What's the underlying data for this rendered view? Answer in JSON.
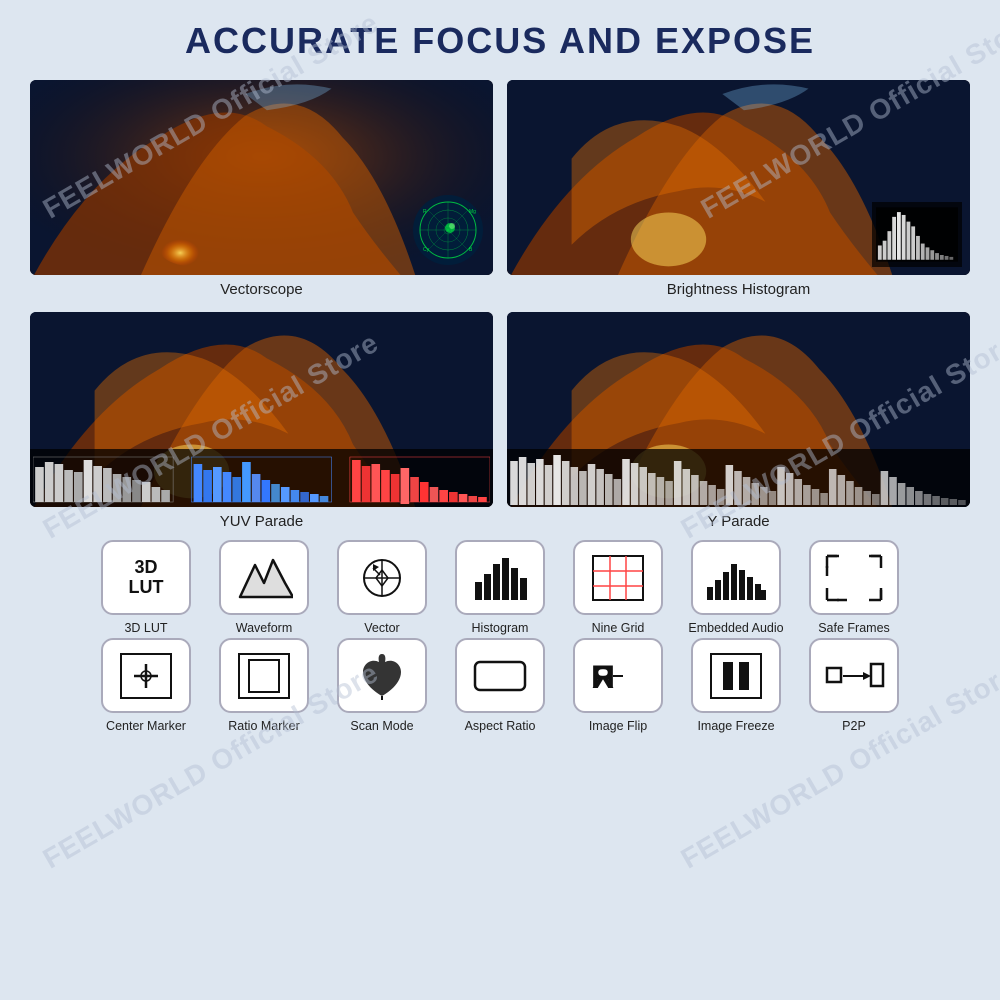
{
  "title": "ACCURATE FOCUS AND EXPOSE",
  "watermark": "FEELWORLD Official Store",
  "images": [
    {
      "id": "vectorscope",
      "caption": "Vectorscope",
      "overlay": "vectorscope"
    },
    {
      "id": "brightness-histogram",
      "caption": "Brightness Histogram",
      "overlay": "histogram"
    },
    {
      "id": "yuv-parade",
      "caption": "YUV Parade",
      "overlay": "yuv"
    },
    {
      "id": "y-parade",
      "caption": "Y Parade",
      "overlay": "y-parade"
    }
  ],
  "icons_row1": [
    {
      "id": "3d-lut",
      "label": "3D LUT",
      "type": "3dlut"
    },
    {
      "id": "waveform",
      "label": "Waveform",
      "type": "waveform"
    },
    {
      "id": "vector",
      "label": "Vector",
      "type": "vector"
    },
    {
      "id": "histogram",
      "label": "Histogram",
      "type": "histogram"
    },
    {
      "id": "nine-grid",
      "label": "Nine Grid",
      "type": "ninegrid"
    },
    {
      "id": "embedded-audio",
      "label": "Embedded Audio",
      "type": "audio"
    },
    {
      "id": "safe-frames",
      "label": "Safe Frames",
      "type": "safeframes"
    }
  ],
  "icons_row2": [
    {
      "id": "center-marker",
      "label": "Center Marker",
      "type": "centermarker"
    },
    {
      "id": "ratio-marker",
      "label": "Ratio Marker",
      "type": "ratiomarker"
    },
    {
      "id": "scan-mode",
      "label": "Scan Mode",
      "type": "scanmode"
    },
    {
      "id": "aspect-ratio",
      "label": "Aspect Ratio",
      "type": "aspectratio"
    },
    {
      "id": "image-flip",
      "label": "Image Flip",
      "type": "imageflip"
    },
    {
      "id": "image-freeze",
      "label": "Image Freeze",
      "type": "imagefreeze"
    },
    {
      "id": "p2p",
      "label": "P2P",
      "type": "p2p"
    }
  ]
}
